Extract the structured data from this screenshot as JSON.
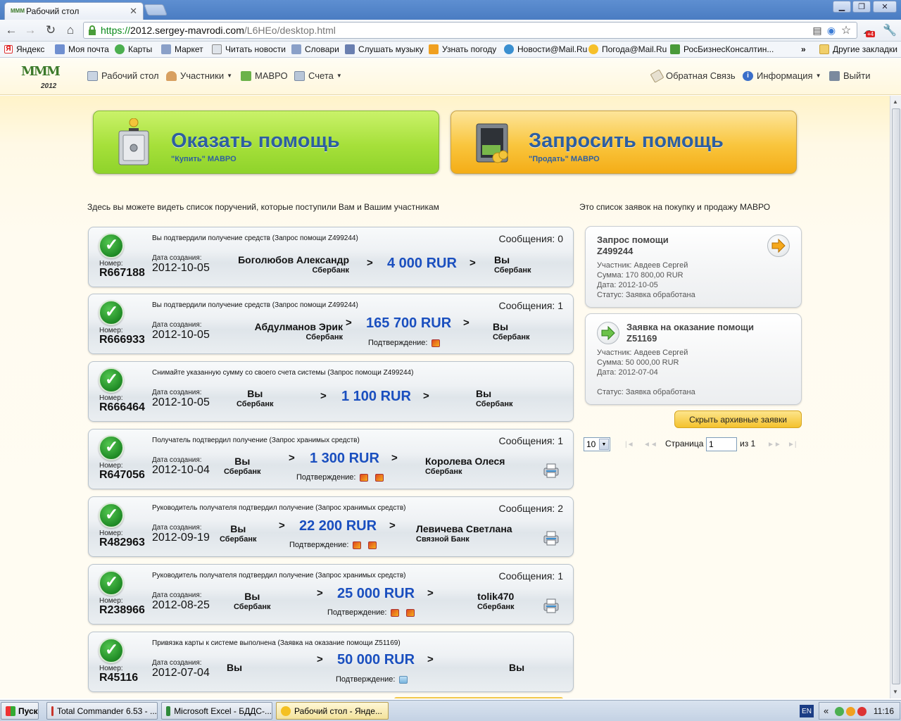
{
  "browser": {
    "tab_title": "Рабочий стол",
    "url": {
      "scheme": "https://",
      "host": "2012.sergey-mavrodi.com",
      "path": "/L6HEo/desktop.html"
    },
    "bookmarks": [
      "Яндекс",
      "Моя почта",
      "Карты",
      "Маркет",
      "Читать новости",
      "Словари",
      "Слушать музыку",
      "Узнать погоду",
      "Новости@Mail.Ru",
      "Погода@Mail.Ru",
      "РосБизнесКонсалтин..."
    ],
    "bookmarks_more": "»",
    "other_bookmarks": "Другие закладки",
    "extension_badge": "+4"
  },
  "site": {
    "logo_text": "МММ",
    "logo_year": "2012",
    "menu": {
      "desktop": "Рабочий стол",
      "participants": "Участники",
      "mavro": "МАВРО",
      "accounts": "Счета",
      "feedback": "Обратная Связь",
      "info": "Информация",
      "logout": "Выйти"
    }
  },
  "actions": {
    "help_title": "Оказать помощь",
    "help_sub": "\"Купить\" МАВРО",
    "request_title": "Запросить помощь",
    "request_sub": "\"Продать\" МАВРО"
  },
  "orders_intro": "Здесь вы можете видеть список поручений, которые поступили Вам и Вашим участникам",
  "requests_intro": "Это список заявок на покупку и продажу МАВРО",
  "labels": {
    "number": "Номер:",
    "created": "Дата создания:",
    "confirm": "Подтверждение:",
    "page": "Страница",
    "of": "из 1",
    "arrow": ">"
  },
  "orders": [
    {
      "desc": "Вы подтвердили получение средств (Запрос помощи Z499244)",
      "messages": "Сообщения: 0",
      "number": "R667188",
      "date": "2012-10-05",
      "from": "Боголюбов Александр",
      "from_bank": "Сбербанк",
      "amount": "4 000 RUR",
      "to": "Вы",
      "to_bank": "Сбербанк"
    },
    {
      "desc": "Вы подтвердили получение средств (Запрос помощи Z499244)",
      "messages": "Сообщения: 1",
      "number": "R666933",
      "date": "2012-10-05",
      "from": "Абдулманов Эрик",
      "from_bank": "Сбербанк",
      "amount": "165 700 RUR",
      "to": "Вы",
      "to_bank": "Сбербанк"
    },
    {
      "desc": "Снимайте указанную сумму со своего счета системы (Запрос помощи Z499244)",
      "messages": "",
      "number": "R666464",
      "date": "2012-10-05",
      "from": "Вы",
      "from_bank": "Сбербанк",
      "amount": "1 100 RUR",
      "to": "Вы",
      "to_bank": "Сбербанк"
    },
    {
      "desc": "Получатель подтвердил получение (Запрос хранимых средств)",
      "messages": "Сообщения: 1",
      "number": "R647056",
      "date": "2012-10-04",
      "from": "Вы",
      "from_bank": "Сбербанк",
      "amount": "1 300 RUR",
      "to": "Королева Олеся",
      "to_bank": "Сбербанк"
    },
    {
      "desc": "Руководитель получателя подтвердил получение (Запрос хранимых средств)",
      "messages": "Сообщения: 2",
      "number": "R482963",
      "date": "2012-09-19",
      "from": "Вы",
      "from_bank": "Сбербанк",
      "amount": "22 200 RUR",
      "to": "Левичева Светлана",
      "to_bank": "Связной Банк"
    },
    {
      "desc": "Руководитель получателя подтвердил получение (Запрос хранимых средств)",
      "messages": "Сообщения: 1",
      "number": "R238966",
      "date": "2012-08-25",
      "from": "Вы",
      "from_bank": "Сбербанк",
      "amount": "25 000 RUR",
      "to": "tolik470",
      "to_bank": "Сбербанк"
    },
    {
      "desc": "Привязка карты к системе выполнена (Заявка на оказание помощи Z51169)",
      "messages": "",
      "number": "R45116",
      "date": "2012-07-04",
      "from": "Вы",
      "from_bank": "",
      "amount": "50 000 RUR",
      "to": "Вы",
      "to_bank": ""
    }
  ],
  "requests": [
    {
      "title": "Запрос помощи",
      "id": "Z499244",
      "participant": "Участник: Авдеев Сергей",
      "sum": "Сумма: 170 800,00 RUR",
      "date": "Дата: 2012-10-05",
      "status": "Статус: Заявка обработана"
    },
    {
      "title": "Заявка на оказание помощи",
      "id": "Z51169",
      "participant": "Участник: Авдеев Сергей",
      "sum": "Сумма: 50 000,00 RUR",
      "date": "Дата: 2012-07-04",
      "status": "Статус: Заявка обработана"
    }
  ],
  "hide_archive": "Скрыть архивные заявки",
  "pager": {
    "page_size": "10",
    "page": "1"
  },
  "taskbar": {
    "start": "Пуск",
    "windows": [
      "Total Commander 6.53 - ...",
      "Microsoft Excel - БДДС-...",
      "Рабочий стол - Янде..."
    ],
    "lang": "EN",
    "clock": "11:16"
  },
  "colors": {
    "amount_blue": "#1a4fbf",
    "green_button": "#a6e03a",
    "orange_button": "#f9c53d",
    "page_bg": "#fff9e6"
  }
}
